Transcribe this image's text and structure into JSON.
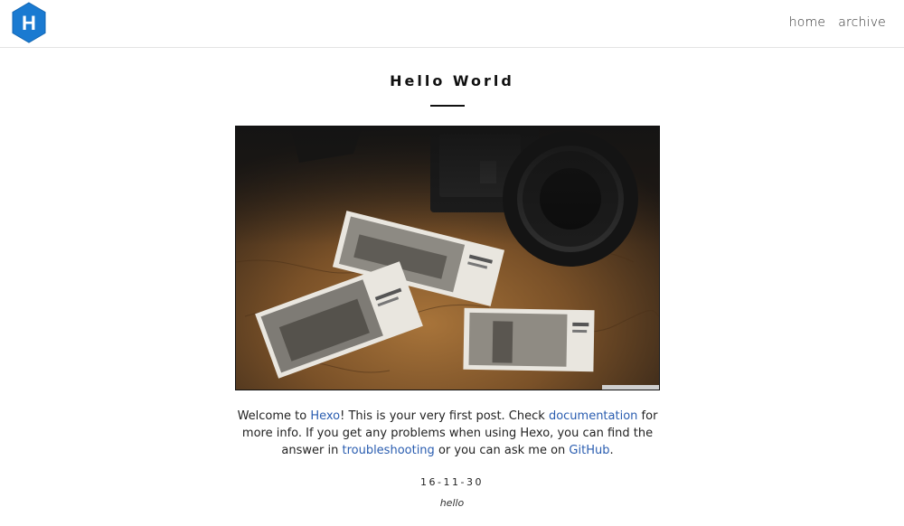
{
  "header": {
    "logo_letter": "H",
    "nav": [
      {
        "label": "home"
      },
      {
        "label": "archive"
      }
    ]
  },
  "post": {
    "title": "Hello World",
    "body": {
      "t1": "Welcome to ",
      "link_hexo": "Hexo",
      "t2": "! This is your very first post. Check ",
      "link_docs": "documentation",
      "t3": " for more info. If you get any problems when using Hexo, you can find the answer in ",
      "link_trouble": "troubleshooting",
      "t4": " or you can ask me on ",
      "link_github": "GitHub",
      "t5": "."
    },
    "date": "16-11-30",
    "tag": "hello"
  },
  "colors": {
    "link": "#2a5db0",
    "logo": "#1a7ad1"
  }
}
